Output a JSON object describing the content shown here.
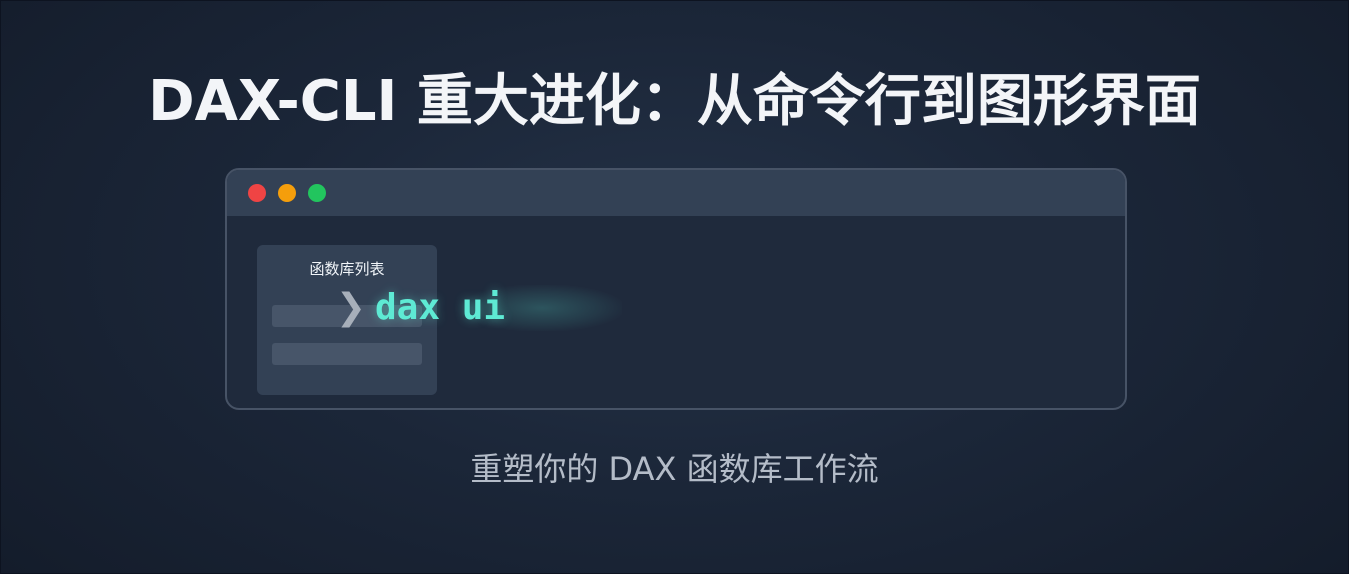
{
  "headline": "DAX-CLI 重大进化：从命令行到图形界面",
  "terminal": {
    "panel_title": "函数库列表",
    "prompt_symbol": "❯",
    "command": "dax ui",
    "dots": {
      "close_color": "#ef4444",
      "minimize_color": "#f59e0b",
      "maximize_color": "#22c55e"
    }
  },
  "subtitle": "重塑你的 DAX 函数库工作流",
  "colors": {
    "command_accent": "#5eead4",
    "background": "#1b2638"
  }
}
